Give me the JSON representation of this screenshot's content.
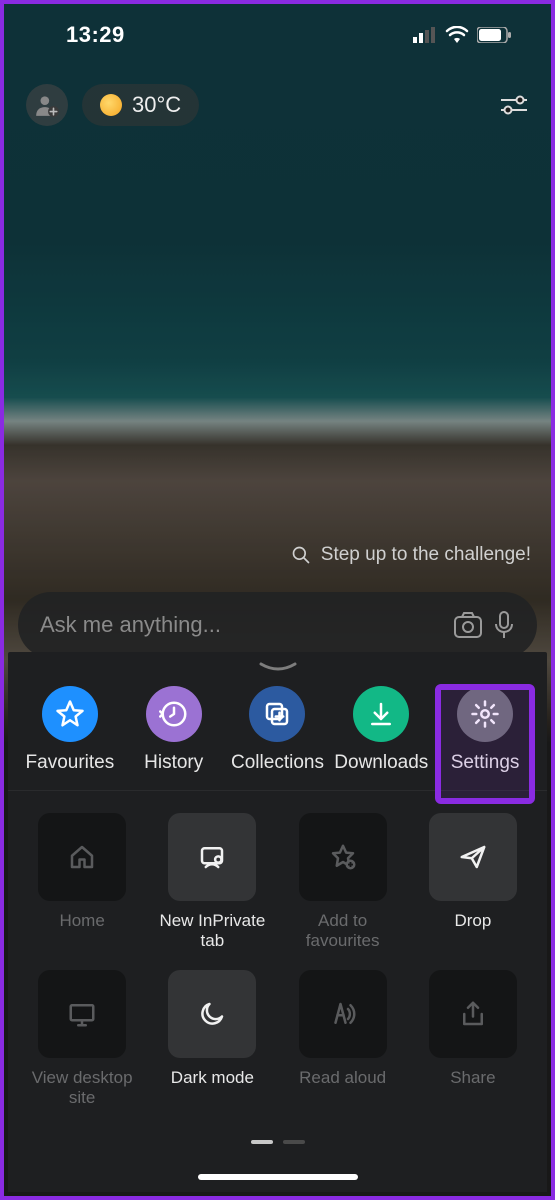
{
  "status": {
    "time": "13:29"
  },
  "weather": {
    "temp": "30°C"
  },
  "hint": {
    "text": "Step up to the challenge!"
  },
  "search": {
    "placeholder": "Ask me anything..."
  },
  "quick": [
    {
      "label": "Favourites",
      "icon": "star-icon",
      "color": "c-blue"
    },
    {
      "label": "History",
      "icon": "history-icon",
      "color": "c-purple"
    },
    {
      "label": "Collections",
      "icon": "collections-icon",
      "color": "c-dblue"
    },
    {
      "label": "Downloads",
      "icon": "download-icon",
      "color": "c-teal"
    },
    {
      "label": "Settings",
      "icon": "gear-icon",
      "color": "c-grey"
    }
  ],
  "highlighted_quick_index": 4,
  "tiles": [
    {
      "label": "Home",
      "icon": "home-icon",
      "enabled": false
    },
    {
      "label": "New InPrivate tab",
      "icon": "inprivate-icon",
      "enabled": true
    },
    {
      "label": "Add to favourites",
      "icon": "star-add-icon",
      "enabled": false
    },
    {
      "label": "Drop",
      "icon": "send-icon",
      "enabled": true
    },
    {
      "label": "View desktop site",
      "icon": "desktop-icon",
      "enabled": false
    },
    {
      "label": "Dark mode",
      "icon": "moon-icon",
      "enabled": true
    },
    {
      "label": "Read aloud",
      "icon": "read-aloud-icon",
      "enabled": false
    },
    {
      "label": "Share",
      "icon": "share-icon",
      "enabled": false
    }
  ],
  "pager": {
    "count": 2,
    "active": 0
  }
}
